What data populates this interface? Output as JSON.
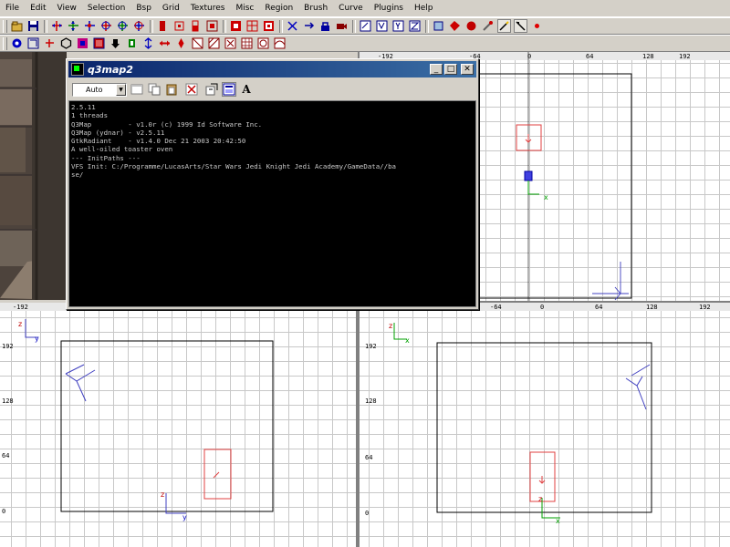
{
  "menu": [
    "File",
    "Edit",
    "View",
    "Selection",
    "Bsp",
    "Grid",
    "Textures",
    "Misc",
    "Region",
    "Brush",
    "Curve",
    "Plugins",
    "Help"
  ],
  "icons": {
    "toolbar1": [
      "open-icon",
      "save-icon",
      "flip-x-icon",
      "flip-y-icon",
      "flip-z-icon",
      "rotate-x-icon",
      "rotate-y-icon",
      "rotate-z-icon",
      "select-complete-tall-icon",
      "select-touching-icon",
      "select-partial-tall-icon",
      "select-inside-icon",
      "csg-subtract-icon",
      "csg-merge-icon",
      "csg-hollow-icon",
      "clipper-icon",
      "change-view-icon",
      "texture-lock-icon",
      "camera-icon",
      "vertex-mode-icon",
      "cube-clip-icon",
      "texture-browser-icon",
      "patch-icon",
      "show-entities-icon",
      "filter-icon"
    ],
    "toolbar2": [
      "view-icon",
      "shader-icon",
      "circle-icon",
      "entity-icon",
      "camera-move-icon",
      "cube-icon",
      "down-arrow-icon",
      "split-icon",
      "patch-mesh-icon",
      "cross-icon",
      "bevel-icon",
      "endcap-icon",
      "cone-icon",
      "brush-icon",
      "sphere-icon",
      "cylinder-icon",
      "light-icon"
    ]
  },
  "viewports": {
    "top": {
      "ruler_x": [
        "-192",
        "-64",
        "0",
        "64",
        "128",
        "192"
      ],
      "axis_x": "x",
      "axis_y": "y"
    },
    "side": {
      "ruler_x": [
        "-192"
      ],
      "ruler_y": [
        "192",
        "128",
        "64",
        "0"
      ],
      "axis_a": "z",
      "axis_b": "y"
    },
    "front": {
      "ruler_x": [
        "-64",
        "0",
        "64",
        "128",
        "192"
      ],
      "ruler_y": [
        "192",
        "128",
        "64",
        "0"
      ],
      "axis_a": "z",
      "axis_b": "x"
    }
  },
  "console": {
    "title": "q3map2",
    "combo_value": "Auto",
    "font_button": "A",
    "lines": [
      "2.5.11",
      "1 threads",
      "Q3Map         - v1.0r (c) 1999 Id Software Inc.",
      "Q3Map (ydnar) - v2.5.11",
      "GtkRadiant    - v1.4.0 Dec 21 2003 20:42:50",
      "A well-oiled toaster oven",
      "--- InitPaths ---",
      "VFS Init: C:/Programme/LucasArts/Star Wars Jedi Knight Jedi Academy/GameData//ba",
      "se/"
    ]
  }
}
